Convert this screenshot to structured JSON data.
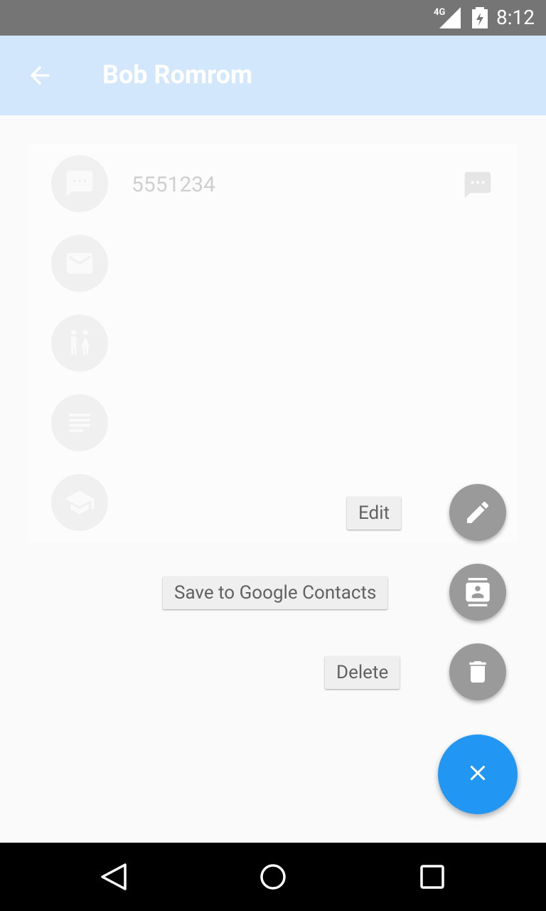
{
  "status_bar": {
    "network": "4G",
    "time": "8:12"
  },
  "app_bar": {
    "title": "Bob Romrom",
    "back_icon": "arrow-back-icon",
    "background_color": "#d2e7fb"
  },
  "contact": {
    "phone": "5551234",
    "rows": [
      {
        "icon": "message-icon"
      },
      {
        "icon": "email-icon"
      },
      {
        "icon": "gender-icon"
      },
      {
        "icon": "notes-icon"
      },
      {
        "icon": "school-icon"
      }
    ]
  },
  "fab_menu": {
    "items": [
      {
        "label": "Edit",
        "icon": "pencil-icon"
      },
      {
        "label": "Save to Google Contacts",
        "icon": "contacts-icon"
      },
      {
        "label": "Delete",
        "icon": "trash-icon"
      }
    ],
    "close_icon": "close-icon",
    "accent_color": "#2196f3"
  },
  "nav_bar": {
    "icons": [
      "back-triangle-icon",
      "home-circle-icon",
      "recents-square-icon"
    ]
  }
}
